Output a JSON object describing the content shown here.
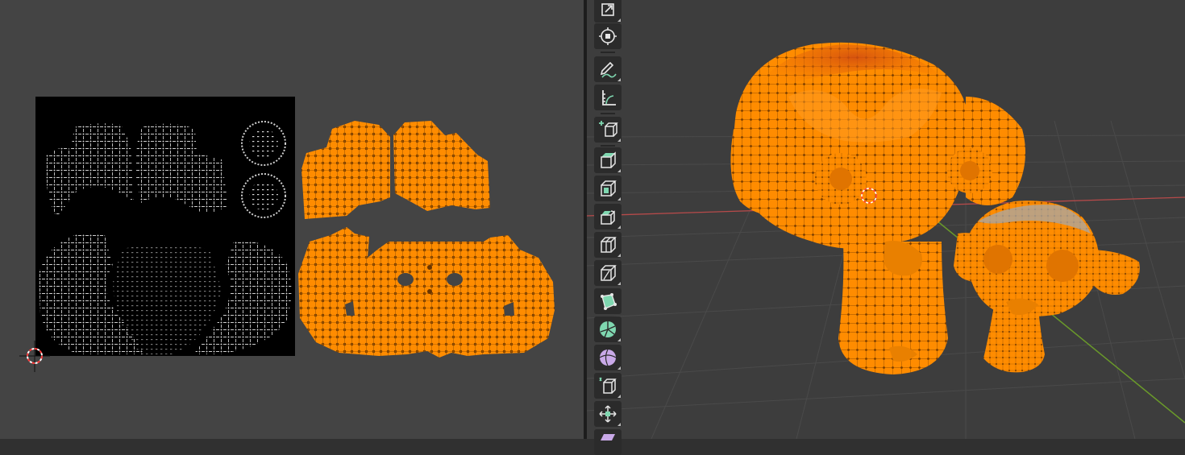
{
  "app": "Blender",
  "uv_editor": {
    "image_background": "#000000",
    "selected_island_color": "#ff8c00",
    "cursor": "2d-cursor-icon"
  },
  "viewport": {
    "selected_mesh_color": "#ff8c00",
    "x_axis_color": "#b64a4a",
    "y_axis_color": "#6a9a2a",
    "objects": [
      "monkey-large",
      "monkey-small"
    ]
  },
  "toolbar": {
    "tools": [
      {
        "name": "scale-tool",
        "icon": "scale-icon"
      },
      {
        "name": "transform-tool",
        "icon": "transform-icon"
      },
      {
        "name": "annotate-tool",
        "icon": "annotate-icon"
      },
      {
        "name": "measure-tool",
        "icon": "measure-icon"
      },
      {
        "name": "add-cube-tool",
        "icon": "add-cube-icon"
      },
      {
        "name": "extrude-region-tool",
        "icon": "extrude-icon"
      },
      {
        "name": "inset-faces-tool",
        "icon": "inset-icon"
      },
      {
        "name": "bevel-tool",
        "icon": "bevel-icon"
      },
      {
        "name": "loop-cut-tool",
        "icon": "loop-cut-icon"
      },
      {
        "name": "knife-tool",
        "icon": "knife-icon"
      },
      {
        "name": "poly-build-tool",
        "icon": "poly-build-icon"
      },
      {
        "name": "spin-tool",
        "icon": "spin-icon"
      },
      {
        "name": "smooth-tool",
        "icon": "smooth-icon"
      },
      {
        "name": "edge-slide-tool",
        "icon": "edge-slide-icon"
      },
      {
        "name": "shrink-fatten-tool",
        "icon": "shrink-fatten-icon"
      },
      {
        "name": "shear-tool",
        "icon": "shear-icon"
      }
    ]
  }
}
